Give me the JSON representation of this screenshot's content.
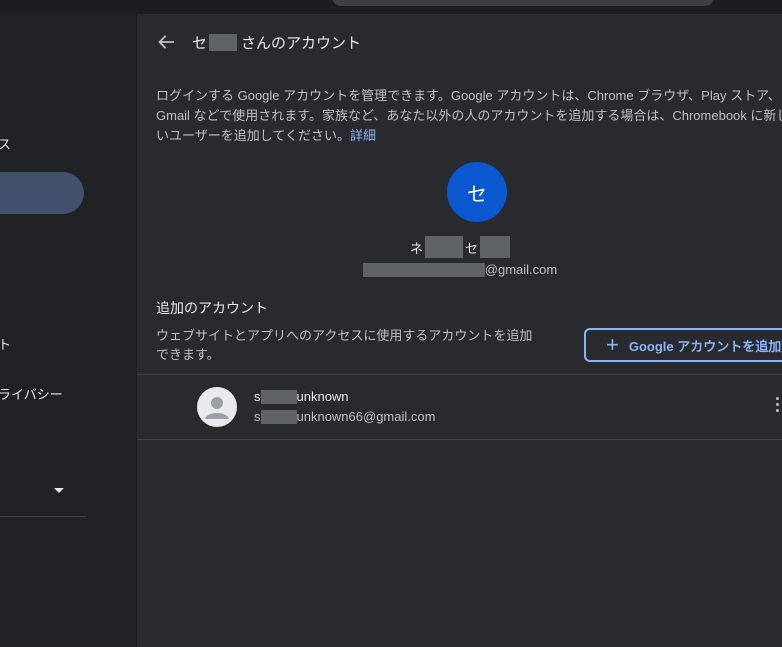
{
  "sidebar": {
    "item1_label": "ス",
    "item2_label": "ト",
    "item3_label": "ライバシー"
  },
  "header": {
    "title_prefix": "セ",
    "title_suffix": "さんのアカウント"
  },
  "description": {
    "line1": "ログインする Google アカウントを管理できます。Google アカウントは、Chrome ブラウザ、Play ストア、",
    "line2": "Gmail などで使用されます。家族など、あなた以外の人のアカウントを追加する場合は、Chromebook に新し",
    "line3": "いユーザーを追加してください。",
    "link": "詳細"
  },
  "primary_account": {
    "initial": "セ",
    "name_part1": "ネ",
    "name_part2": "セ",
    "email_suffix": "@gmail.com"
  },
  "additional": {
    "title": "追加のアカウント",
    "desc_line1": "ウェブサイトとアプリへのアクセスに使用するアカウントを追加",
    "desc_line2": "できます。",
    "add_button": "Google アカウントを追加"
  },
  "accounts": [
    {
      "name_prefix": "s",
      "name_suffix": "unknown",
      "email_prefix": "s",
      "email_suffix": "unknown66@gmail.com"
    }
  ],
  "colors": {
    "accent": "#8ab4f8",
    "avatar_blue": "#0b57d0",
    "panel_bg": "#292a2d",
    "page_bg": "#202124"
  }
}
